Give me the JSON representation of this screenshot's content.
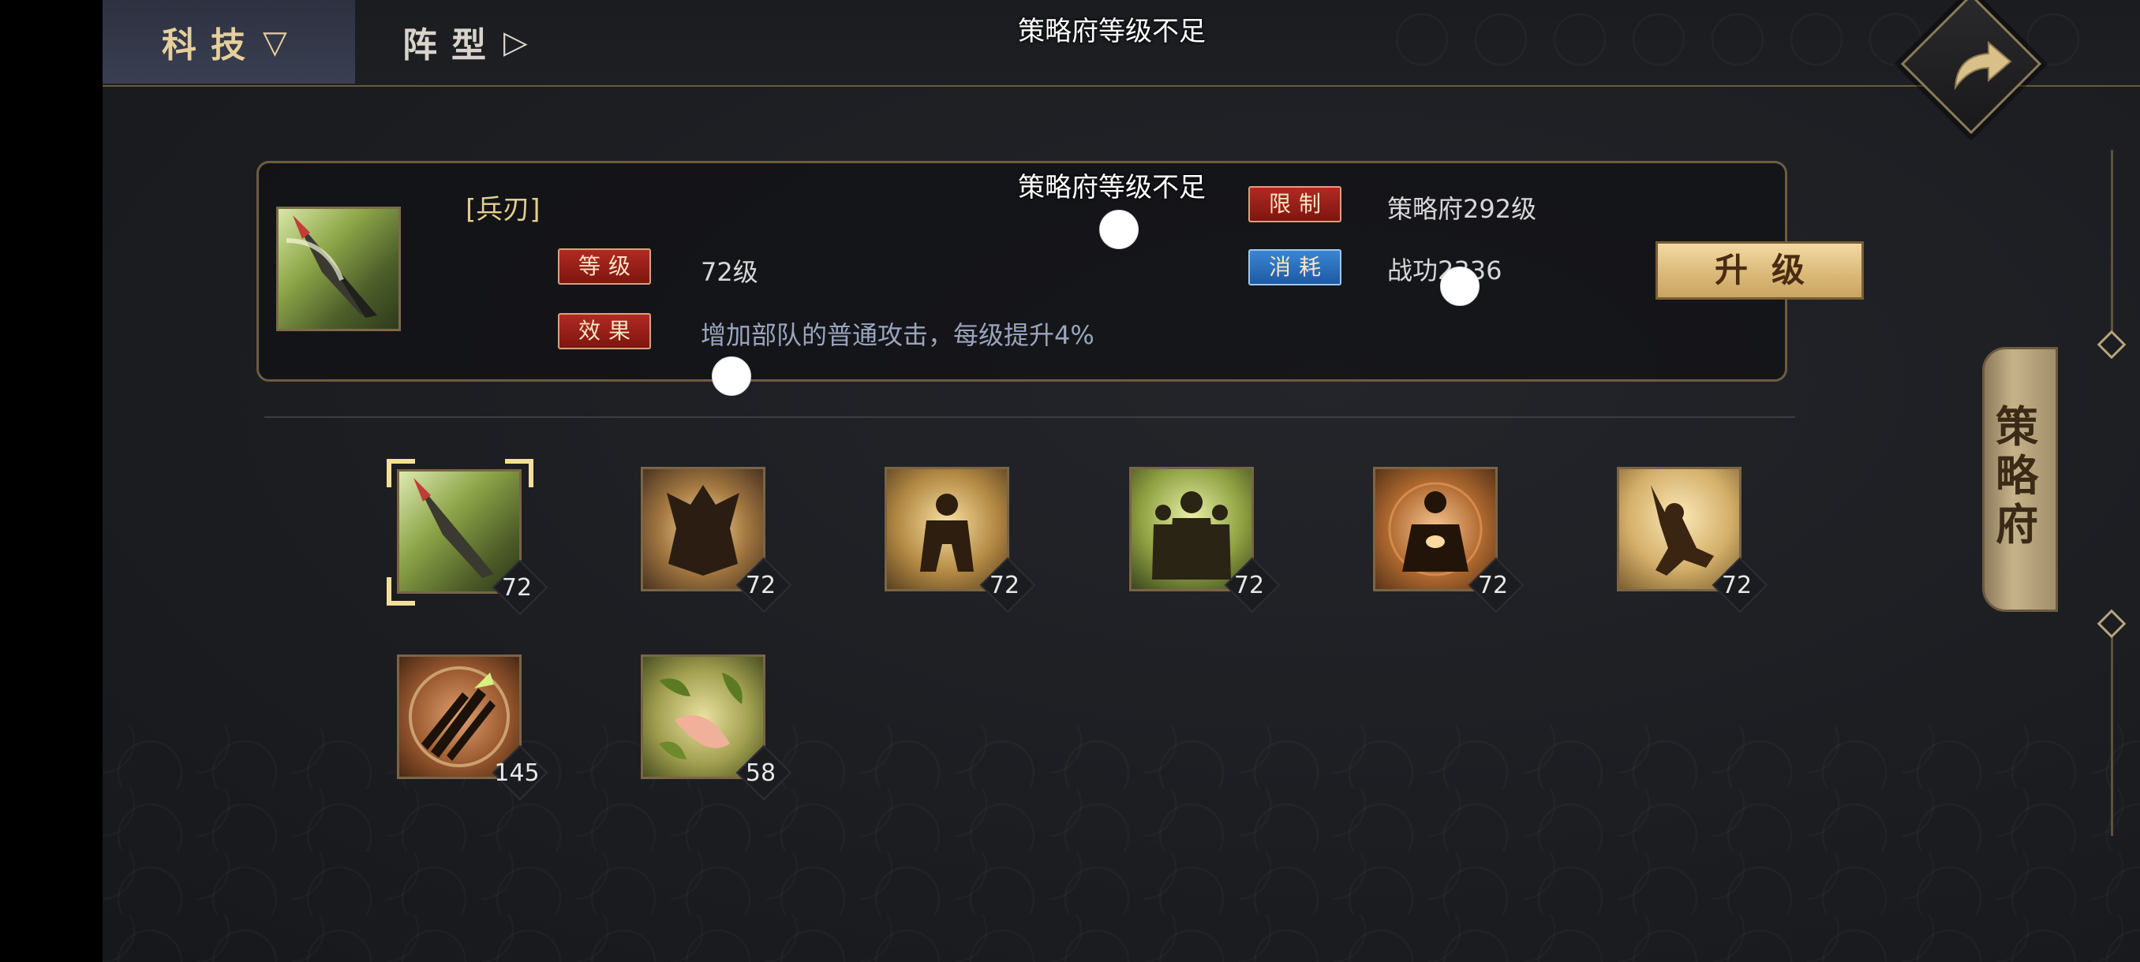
{
  "tabs": [
    {
      "label": "科技",
      "arrow": "▽",
      "active": true
    },
    {
      "label": "阵型",
      "arrow": "▷",
      "active": false
    }
  ],
  "toasts": [
    "策略府等级不足",
    "策略府等级不足"
  ],
  "detail": {
    "name": "[兵刃]",
    "level_tag": "等级",
    "level_value": "72级",
    "effect_tag": "效果",
    "effect_value": "增加部队的普通攻击，每级提升4%",
    "limit_tag": "限制",
    "limit_value": "策略府292级",
    "cost_tag": "消耗",
    "cost_value": "战功2336",
    "upgrade_label": "升级"
  },
  "techs": [
    {
      "icon": "blade-icon",
      "level": "72",
      "selected": true
    },
    {
      "icon": "armor-icon",
      "level": "72"
    },
    {
      "icon": "warrior-icon",
      "level": "72"
    },
    {
      "icon": "troops-icon",
      "level": "72"
    },
    {
      "icon": "meditate-icon",
      "level": "72"
    },
    {
      "icon": "martial-pose-icon",
      "level": "72"
    },
    {
      "icon": "crossed-swords-icon",
      "level": "145"
    },
    {
      "icon": "leaf-hand-icon",
      "level": "58"
    }
  ],
  "side_tab": {
    "label": "策略府"
  },
  "colors": {
    "accent_gold": "#e6cf9c",
    "tag_red": "#b12a23",
    "tag_blue": "#3a86d4",
    "button_gold": "#d9b877"
  }
}
